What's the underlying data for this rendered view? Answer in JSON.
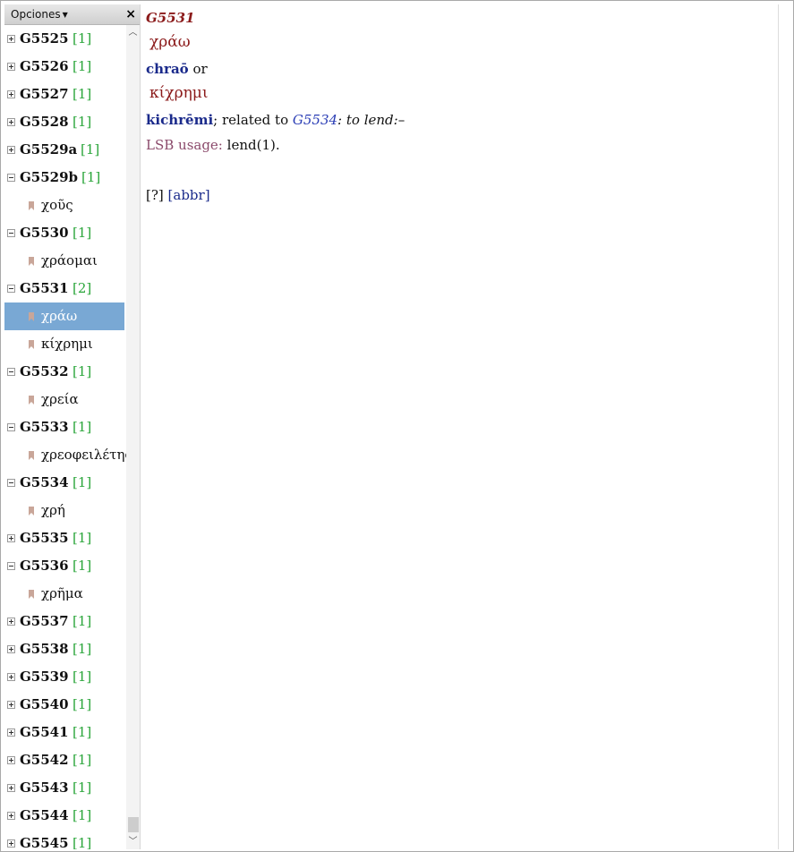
{
  "options_label": "Opciones",
  "close_label": "×",
  "tree": [
    {
      "kind": "node",
      "code": "G5525",
      "count": "[1]",
      "expanded": false
    },
    {
      "kind": "node",
      "code": "G5526",
      "count": "[1]",
      "expanded": false
    },
    {
      "kind": "node",
      "code": "G5527",
      "count": "[1]",
      "expanded": false
    },
    {
      "kind": "node",
      "code": "G5528",
      "count": "[1]",
      "expanded": false
    },
    {
      "kind": "node",
      "code": "G5529a",
      "count": "[1]",
      "expanded": false
    },
    {
      "kind": "node",
      "code": "G5529b",
      "count": "[1]",
      "expanded": true
    },
    {
      "kind": "leaf",
      "text": "χοῦς",
      "selected": false
    },
    {
      "kind": "node",
      "code": "G5530",
      "count": "[1]",
      "expanded": true
    },
    {
      "kind": "leaf",
      "text": "χράομαι",
      "selected": false
    },
    {
      "kind": "node",
      "code": "G5531",
      "count": "[2]",
      "expanded": true
    },
    {
      "kind": "leaf",
      "text": "χράω",
      "selected": true
    },
    {
      "kind": "leaf",
      "text": "κίχρημι",
      "selected": false
    },
    {
      "kind": "node",
      "code": "G5532",
      "count": "[1]",
      "expanded": true
    },
    {
      "kind": "leaf",
      "text": "χρεία",
      "selected": false
    },
    {
      "kind": "node",
      "code": "G5533",
      "count": "[1]",
      "expanded": true
    },
    {
      "kind": "leaf",
      "text": "χρεοφειλέτης",
      "selected": false
    },
    {
      "kind": "node",
      "code": "G5534",
      "count": "[1]",
      "expanded": true
    },
    {
      "kind": "leaf",
      "text": "χρή",
      "selected": false
    },
    {
      "kind": "node",
      "code": "G5535",
      "count": "[1]",
      "expanded": false
    },
    {
      "kind": "node",
      "code": "G5536",
      "count": "[1]",
      "expanded": true
    },
    {
      "kind": "leaf",
      "text": "χρῆμα",
      "selected": false
    },
    {
      "kind": "node",
      "code": "G5537",
      "count": "[1]",
      "expanded": false
    },
    {
      "kind": "node",
      "code": "G5538",
      "count": "[1]",
      "expanded": false
    },
    {
      "kind": "node",
      "code": "G5539",
      "count": "[1]",
      "expanded": false
    },
    {
      "kind": "node",
      "code": "G5540",
      "count": "[1]",
      "expanded": false
    },
    {
      "kind": "node",
      "code": "G5541",
      "count": "[1]",
      "expanded": false
    },
    {
      "kind": "node",
      "code": "G5542",
      "count": "[1]",
      "expanded": false
    },
    {
      "kind": "node",
      "code": "G5543",
      "count": "[1]",
      "expanded": false
    },
    {
      "kind": "node",
      "code": "G5544",
      "count": "[1]",
      "expanded": false
    },
    {
      "kind": "node",
      "code": "G5545",
      "count": "[1]",
      "expanded": false
    }
  ],
  "entry": {
    "id": "G5531",
    "greek1": "χράω",
    "translit1": "chraō",
    "or_word": "or",
    "greek2": "κίχρημι",
    "translit2": "kichrēmi",
    "related_text": "; related to",
    "related_ref": "G5534",
    "related_def": ": to lend:",
    "dash": "–",
    "lsb_label": "LSB usage:",
    "lsb_value": "lend(1).",
    "q_link": "[?]",
    "abbr_link": "[abbr]"
  },
  "colors": {
    "selected_bg": "#79a8d4",
    "count_green": "#2aa53a",
    "greek_red": "#8b1a1a",
    "translit_blue": "#1a2a8b"
  }
}
